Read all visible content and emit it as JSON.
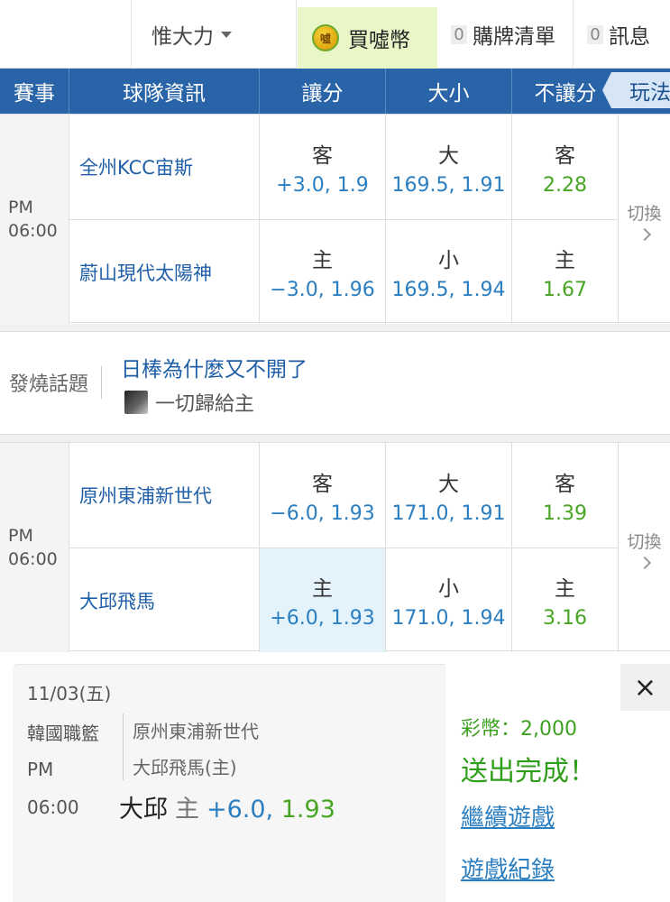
{
  "topbar": {
    "username": "惟大力",
    "coin_button": "買噓幣",
    "coin_icon_char": "噓",
    "cart_count": "0",
    "cart_label": "購牌清單",
    "msg_count": "0",
    "msg_label": "訊息"
  },
  "header": {
    "col_event": "賽事",
    "col_team": "球隊資訊",
    "col_handicap": "讓分",
    "col_overunder": "大小",
    "col_moneyline": "不讓分",
    "col_play": "玩法"
  },
  "matches": [
    {
      "period": "PM",
      "time": "06:00",
      "away_team": "全州KCC宙斯",
      "home_team": "蔚山現代太陽神",
      "handicap": [
        {
          "label": "客",
          "value": "+3.0, 1.9"
        },
        {
          "label": "主",
          "value": "−3.0, 1.96"
        }
      ],
      "overunder": [
        {
          "label": "大",
          "value": "169.5, 1.91"
        },
        {
          "label": "小",
          "value": "169.5, 1.94"
        }
      ],
      "moneyline": [
        {
          "label": "客",
          "value": "2.28"
        },
        {
          "label": "主",
          "value": "1.67"
        }
      ],
      "switch_label": "切換"
    },
    {
      "period": "PM",
      "time": "06:00",
      "away_team": "原州東浦新世代",
      "home_team": "大邱飛馬",
      "handicap": [
        {
          "label": "客",
          "value": "−6.0, 1.93"
        },
        {
          "label": "主",
          "value": "+6.0, 1.93"
        }
      ],
      "overunder": [
        {
          "label": "大",
          "value": "171.0, 1.91"
        },
        {
          "label": "小",
          "value": "171.0, 1.94"
        }
      ],
      "moneyline": [
        {
          "label": "客",
          "value": "1.39"
        },
        {
          "label": "主",
          "value": "3.16"
        }
      ],
      "switch_label": "切換"
    }
  ],
  "hot_topic": {
    "label": "發燒話題",
    "title": "日棒為什麼又不開了",
    "author": "一切歸給主"
  },
  "bet_slip": {
    "date": "11/03(五)",
    "league": "韓國職籃",
    "period": "PM",
    "time": "06:00",
    "away_team": "原州東浦新世代",
    "home_team_label": "大邱飛馬(主)",
    "pick_team": "大邱",
    "pick_side": "主",
    "pick_line": "+6.0,",
    "pick_odds": "1.93",
    "coin_text": "彩幣：2,000",
    "done_text": "送出完成！",
    "continue_link": "繼續遊戲",
    "history_link": "遊戲紀錄",
    "close_symbol": "×"
  },
  "colors": {
    "header_bg": "#2a64a8",
    "link_blue": "#2b7ec0",
    "odds_green": "#48a523",
    "coin_bg": "#e8f6c8",
    "selected_bg": "#e3f2fb"
  }
}
